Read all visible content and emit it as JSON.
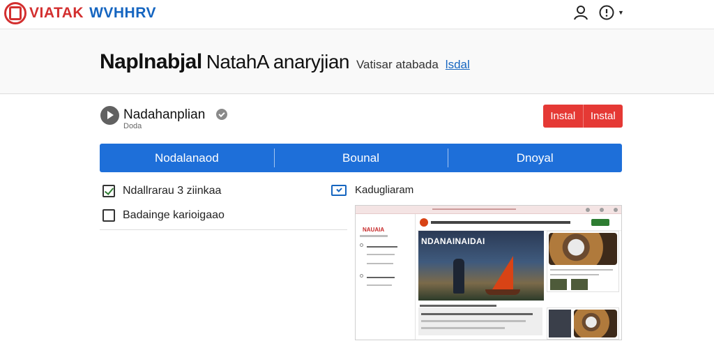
{
  "brand": {
    "name_red": "VIATAK",
    "name_blue": "WVHHRV"
  },
  "header": {
    "title_bold": "Naplnabjal",
    "title_rest": "NatahA anaryjian",
    "subtitle": "Vatisar atabada",
    "link": "lsdal"
  },
  "item": {
    "title": "Nadahanplian",
    "subtitle": "Doda",
    "install_labels": [
      "Instal",
      "Instal"
    ]
  },
  "tabs": [
    "Nodalanaod",
    "Bounal",
    "Dnoyal"
  ],
  "options": [
    {
      "label": "Ndallrarau 3 ziinkaa",
      "checked": true
    },
    {
      "label": "Badainge karioigaao",
      "checked": false
    }
  ],
  "preview": {
    "label": "Kadugliaram",
    "site_brand": "NAUAIA",
    "hero_title": "NDANAINAIDAI"
  },
  "colors": {
    "accent": "#1e6fd9",
    "install": "#e53935",
    "brand_red": "#d32f2f",
    "brand_blue": "#1565c0"
  }
}
